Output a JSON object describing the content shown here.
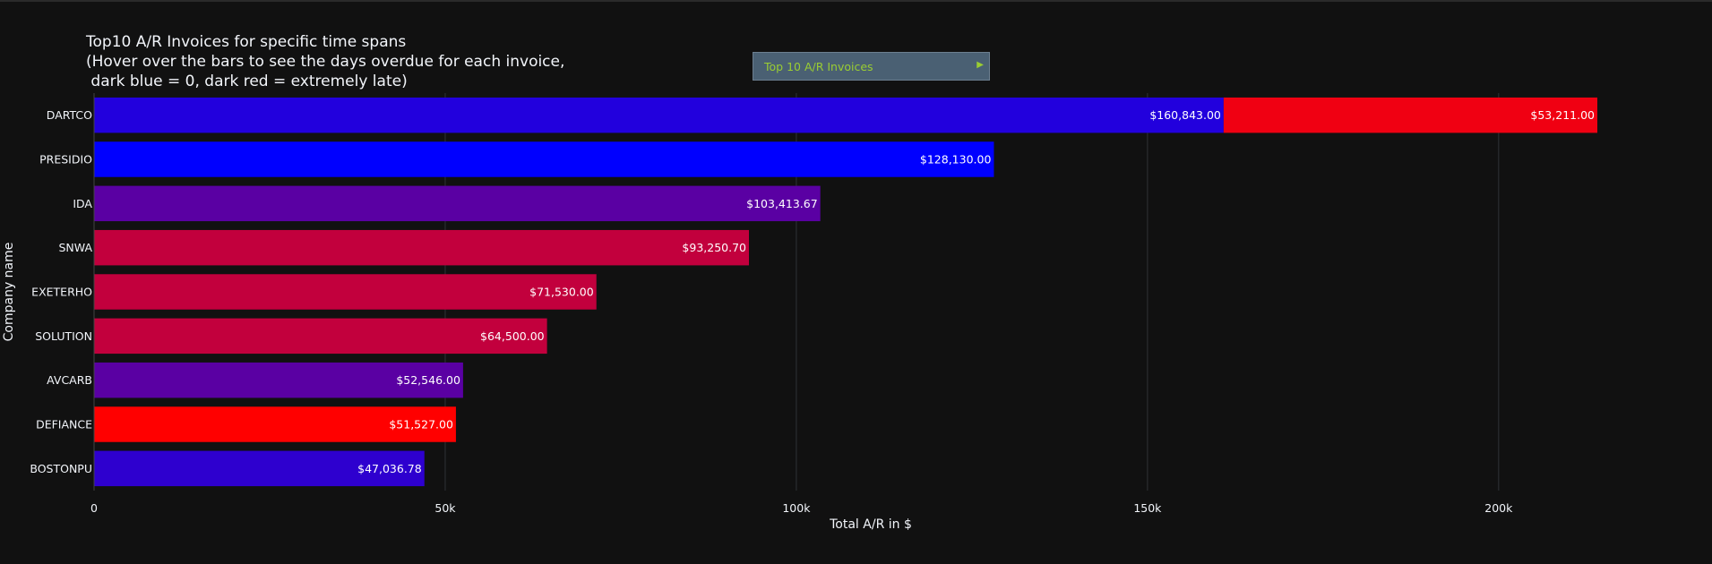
{
  "title_lines": [
    "Top10 A/R Invoices for specific time spans",
    "(Hover over the bars to see the days overdue for each invoice,",
    " dark blue = 0, dark red = extremely late)"
  ],
  "dropdown": {
    "label": "Top 10 A/R Invoices",
    "arrow": "▶"
  },
  "chart_data": {
    "type": "bar",
    "orientation": "horizontal",
    "barmode": "stack",
    "xlabel": "Total A/R in $",
    "ylabel": "Company name",
    "xlim": [
      0,
      230000
    ],
    "xticks": [
      0,
      50000,
      100000,
      150000,
      200000
    ],
    "xtick_labels": [
      "0",
      "50k",
      "100k",
      "150k",
      "200k"
    ],
    "grid": true,
    "categories": [
      "DARTCO",
      "PRESIDIO",
      "IDA",
      "SNWA",
      "EXETERHO",
      "SOLUTION",
      "AVCARB",
      "DEFIANCE",
      "BOSTONPU"
    ],
    "bars": [
      {
        "category": "DARTCO",
        "segments": [
          {
            "value": 160843.0,
            "label": "$160,843.00",
            "color": "#2200dd"
          },
          {
            "value": 53211.0,
            "label": "$53,211.00",
            "color": "#f00012"
          }
        ]
      },
      {
        "category": "PRESIDIO",
        "segments": [
          {
            "value": 128130.0,
            "label": "$128,130.00",
            "color": "#0000ff"
          }
        ]
      },
      {
        "category": "IDA",
        "segments": [
          {
            "value": 103413.67,
            "label": "$103,413.67",
            "color": "#5a00a3"
          }
        ]
      },
      {
        "category": "SNWA",
        "segments": [
          {
            "value": 93250.7,
            "label": "$93,250.70",
            "color": "#c2003d"
          }
        ]
      },
      {
        "category": "EXETERHO",
        "segments": [
          {
            "value": 71530.0,
            "label": "$71,530.00",
            "color": "#c2003d"
          }
        ]
      },
      {
        "category": "SOLUTION",
        "segments": [
          {
            "value": 64500.0,
            "label": "$64,500.00",
            "color": "#c2003d"
          }
        ]
      },
      {
        "category": "AVCARB",
        "segments": [
          {
            "value": 52546.0,
            "label": "$52,546.00",
            "color": "#5a00a3"
          }
        ]
      },
      {
        "category": "DEFIANCE",
        "segments": [
          {
            "value": 51527.0,
            "label": "$51,527.00",
            "color": "#ff0000"
          }
        ]
      },
      {
        "category": "BOSTONPU",
        "segments": [
          {
            "value": 47036.78,
            "label": "$47,036.78",
            "color": "#2e00cf"
          }
        ]
      }
    ]
  }
}
